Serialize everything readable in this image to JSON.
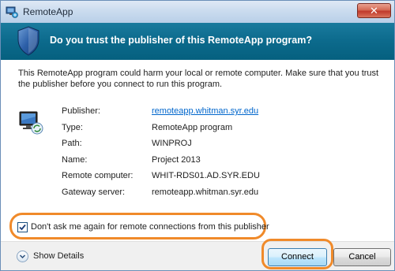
{
  "window": {
    "title": "RemoteApp",
    "close_label": "✕"
  },
  "header": {
    "text": "Do you trust the publisher of this RemoteApp program?"
  },
  "warning": "This RemoteApp program could harm your local or remote computer. Make sure that you trust the publisher before you connect to run this program.",
  "details": {
    "rows": [
      {
        "label": "Publisher:",
        "value": "remoteapp.whitman.syr.edu"
      },
      {
        "label": "Type:",
        "value": "RemoteApp program"
      },
      {
        "label": "Path:",
        "value": "WINPROJ"
      },
      {
        "label": "Name:",
        "value": "Project 2013"
      },
      {
        "label": "Remote computer:",
        "value": "WHIT-RDS01.AD.SYR.EDU"
      },
      {
        "label": "Gateway server:",
        "value": "remoteapp.whitman.syr.edu"
      }
    ]
  },
  "checkbox": {
    "label": "Don't ask me again for remote connections from this publisher",
    "checked": true
  },
  "footer": {
    "show_details_label": "Show Details",
    "connect_label": "Connect",
    "cancel_label": "Cancel"
  },
  "icons": {
    "app": "remoteapp-icon",
    "header": "shield-icon",
    "computer": "remote-computer-icon",
    "show_details": "chevron-down-icon"
  },
  "colors": {
    "header_bg": "#0c6a8c",
    "link": "#0066cc",
    "highlight": "#f08a2a"
  }
}
